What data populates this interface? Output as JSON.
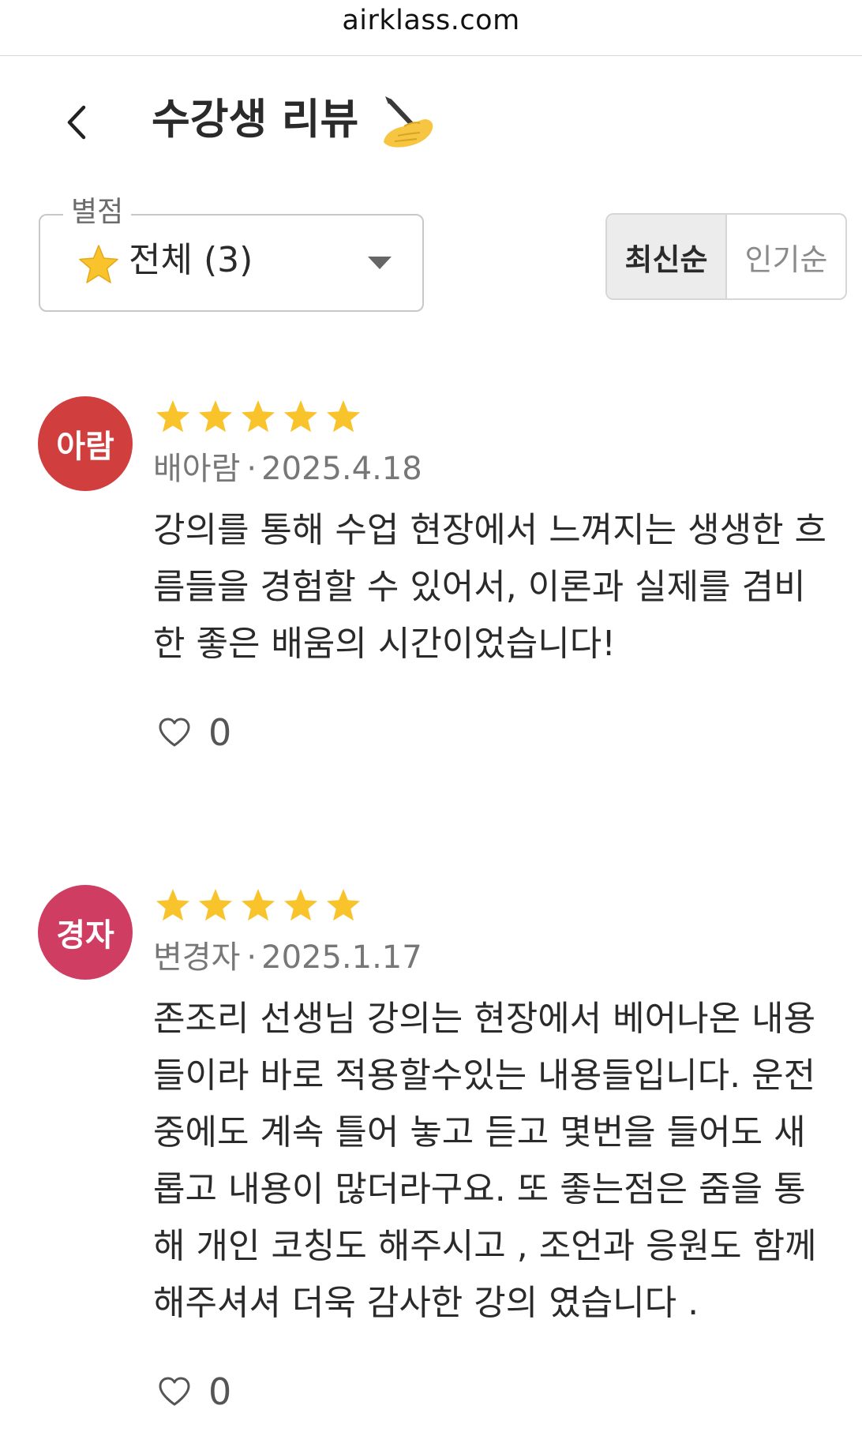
{
  "browser": {
    "url": "airklass.com"
  },
  "header": {
    "back_icon": "chevron-left-icon",
    "title": "수강생 리뷰",
    "title_emoji": "writing-hand-icon"
  },
  "filter": {
    "legend": "별점",
    "star_icon": "star-icon",
    "value": "전체 (3)",
    "dropdown_icon": "caret-down-icon"
  },
  "sort": {
    "options": [
      {
        "label": "최신순",
        "active": true
      },
      {
        "label": "인기순",
        "active": false
      }
    ]
  },
  "colors": {
    "star": "#f8c32b",
    "avatar_1": "#d03e3e",
    "avatar_2": "#cf3d63",
    "text_muted": "#777777"
  },
  "reviews": [
    {
      "avatar_text": "아람",
      "rating": 5,
      "author": "배아람",
      "separator": "·",
      "date": "2025.4.18",
      "body": "강의를 통해 수업 현장에서 느껴지는 생생한 흐\n름들을 경험할 수 있어서, 이론과 실제를 겸비\n한 좋은 배움의 시간이었습니다!",
      "likes": "0"
    },
    {
      "avatar_text": "경자",
      "rating": 5,
      "author": "변경자",
      "separator": "·",
      "date": "2025.1.17",
      "body": "존조리 선생님 강의는 현장에서 베어나온 내용\n들이라 바로 적용할수있는 내용들입니다.  운전\n중에도 계속 틀어 놓고 듣고 몇번을 들어도 새\n롭고 내용이 많더라구요. 또 좋는점은 줌을 통\n해 개인 코칭도 해주시고 , 조언과 응원도 함께\n해주셔셔 더욱 감사한 강의 였습니다 .",
      "likes": "0"
    }
  ]
}
